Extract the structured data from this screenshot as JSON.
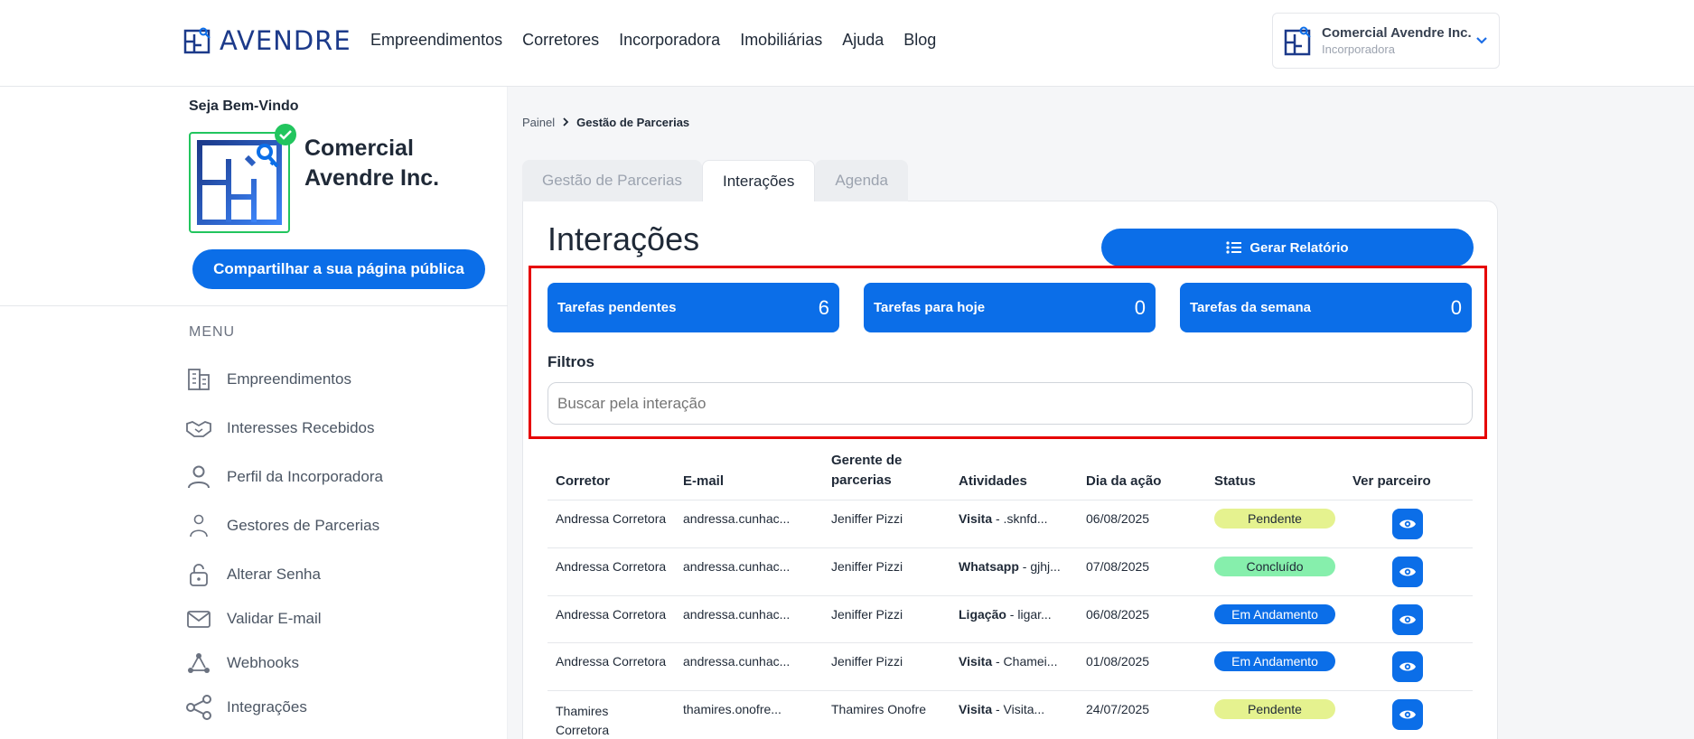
{
  "brand": {
    "name": "AVENDRE",
    "accent": "#0b6ee8",
    "dark": "#1c3a8a"
  },
  "nav": [
    "Empreendimentos",
    "Corretores",
    "Incorporadora",
    "Imobiliárias",
    "Ajuda",
    "Blog"
  ],
  "account": {
    "name": "Comercial Avendre Inc.",
    "role": "Incorporadora"
  },
  "sidebar": {
    "welcome": "Seja Bem-Vindo",
    "company": "Comercial Avendre Inc.",
    "share": "Compartilhar a sua página pública",
    "menu_title": "MENU",
    "items": [
      {
        "label": "Empreendimentos",
        "icon": "building-icon"
      },
      {
        "label": "Interesses Recebidos",
        "icon": "handshake-icon"
      },
      {
        "label": "Perfil da Incorporadora",
        "icon": "user-icon"
      },
      {
        "label": "Gestores de Parcerias",
        "icon": "user-outline-icon"
      },
      {
        "label": "Alterar Senha",
        "icon": "lock-icon"
      },
      {
        "label": "Validar E-mail",
        "icon": "mail-icon"
      },
      {
        "label": "Webhooks",
        "icon": "webhook-icon"
      },
      {
        "label": "Integrações",
        "icon": "share-nodes-icon"
      }
    ]
  },
  "breadcrumb": {
    "root": "Painel",
    "current": "Gestão de Parcerias"
  },
  "tabs": [
    {
      "label": "Gestão de Parcerias",
      "active": false
    },
    {
      "label": "Interações",
      "active": true
    },
    {
      "label": "Agenda",
      "active": false
    }
  ],
  "page": {
    "title": "Interações",
    "report_button": "Gerar Relatório"
  },
  "stats": [
    {
      "label": "Tarefas pendentes",
      "value": "6"
    },
    {
      "label": "Tarefas para hoje",
      "value": "0"
    },
    {
      "label": "Tarefas da semana",
      "value": "0"
    }
  ],
  "filters": {
    "title": "Filtros",
    "search_placeholder": "Buscar pela interação"
  },
  "table": {
    "headers": [
      "Corretor",
      "E-mail",
      "Gerente de parcerias",
      "Atividades",
      "Dia da ação",
      "Status",
      "Ver parceiro"
    ],
    "rows": [
      {
        "corretor": "Andressa Corretora",
        "email": "andressa.cunhac...",
        "gerente": "Jeniffer Pizzi",
        "atividade_tipo": "Visita",
        "atividade_desc": " - .sknfd...",
        "dia": "06/08/2025",
        "status": "Pendente"
      },
      {
        "corretor": "Andressa Corretora",
        "email": "andressa.cunhac...",
        "gerente": "Jeniffer Pizzi",
        "atividade_tipo": "Whatsapp",
        "atividade_desc": " - gjhj...",
        "dia": "07/08/2025",
        "status": "Concluído"
      },
      {
        "corretor": "Andressa Corretora",
        "email": "andressa.cunhac...",
        "gerente": "Jeniffer Pizzi",
        "atividade_tipo": "Ligação",
        "atividade_desc": " - ligar...",
        "dia": "06/08/2025",
        "status": "Em Andamento"
      },
      {
        "corretor": "Andressa Corretora",
        "email": "andressa.cunhac...",
        "gerente": "Jeniffer Pizzi",
        "atividade_tipo": "Visita",
        "atividade_desc": " - Chamei...",
        "dia": "01/08/2025",
        "status": "Em Andamento"
      },
      {
        "corretor": "Thamires Corretora",
        "email": "thamires.onofre...",
        "gerente": "Thamires Onofre",
        "atividade_tipo": "Visita",
        "atividade_desc": " - Visita...",
        "dia": "24/07/2025",
        "status": "Pendente"
      }
    ],
    "status_colors": {
      "Pendente": {
        "bg": "#e5f28f",
        "fg": "#1f2937"
      },
      "Concluído": {
        "bg": "#86efac",
        "fg": "#1f2937"
      },
      "Em Andamento": {
        "bg": "#0b6ee8",
        "fg": "#ffffff"
      }
    }
  }
}
